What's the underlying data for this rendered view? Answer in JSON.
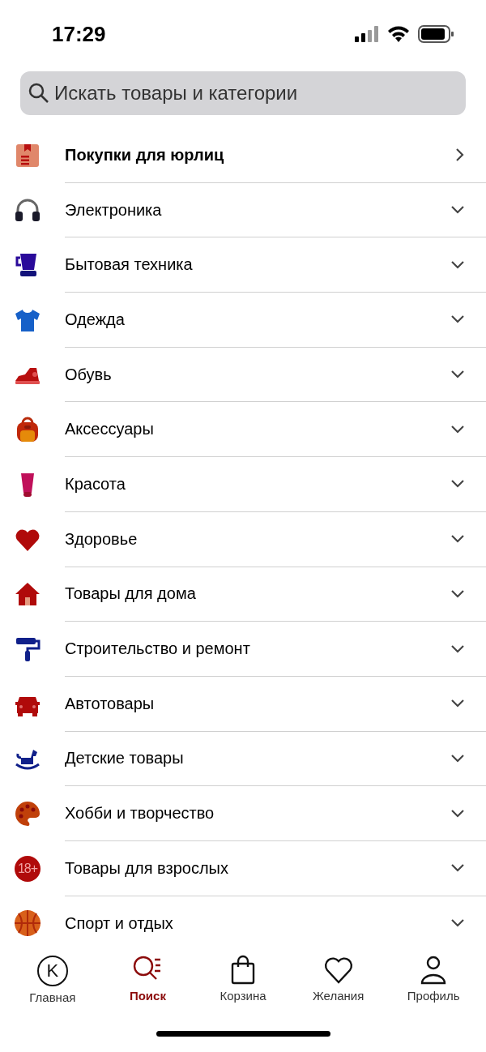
{
  "status_bar": {
    "time": "17:29"
  },
  "search": {
    "placeholder": "Искать товары и категории"
  },
  "categories": [
    {
      "label": "Покупки для юрлиц",
      "kind": "link"
    },
    {
      "label": "Электроника",
      "kind": "group"
    },
    {
      "label": "Бытовая техника",
      "kind": "group"
    },
    {
      "label": "Одежда",
      "kind": "group"
    },
    {
      "label": "Обувь",
      "kind": "group"
    },
    {
      "label": "Аксессуары",
      "kind": "group"
    },
    {
      "label": "Красота",
      "kind": "group"
    },
    {
      "label": "Здоровье",
      "kind": "group"
    },
    {
      "label": "Товары для дома",
      "kind": "group"
    },
    {
      "label": "Строительство и ремонт",
      "kind": "group"
    },
    {
      "label": "Автотовары",
      "kind": "group"
    },
    {
      "label": "Детские товары",
      "kind": "group"
    },
    {
      "label": "Хобби и творчество",
      "kind": "group"
    },
    {
      "label": "Товары для взрослых",
      "kind": "group",
      "badge": "18+"
    },
    {
      "label": "Спорт и отдых",
      "kind": "group"
    }
  ],
  "tab_bar": {
    "logo_letter": "K",
    "tabs": [
      {
        "label": "Главная",
        "selected": false
      },
      {
        "label": "Поиск",
        "selected": true
      },
      {
        "label": "Корзина",
        "selected": false
      },
      {
        "label": "Желания",
        "selected": false
      },
      {
        "label": "Профиль",
        "selected": false
      }
    ]
  }
}
